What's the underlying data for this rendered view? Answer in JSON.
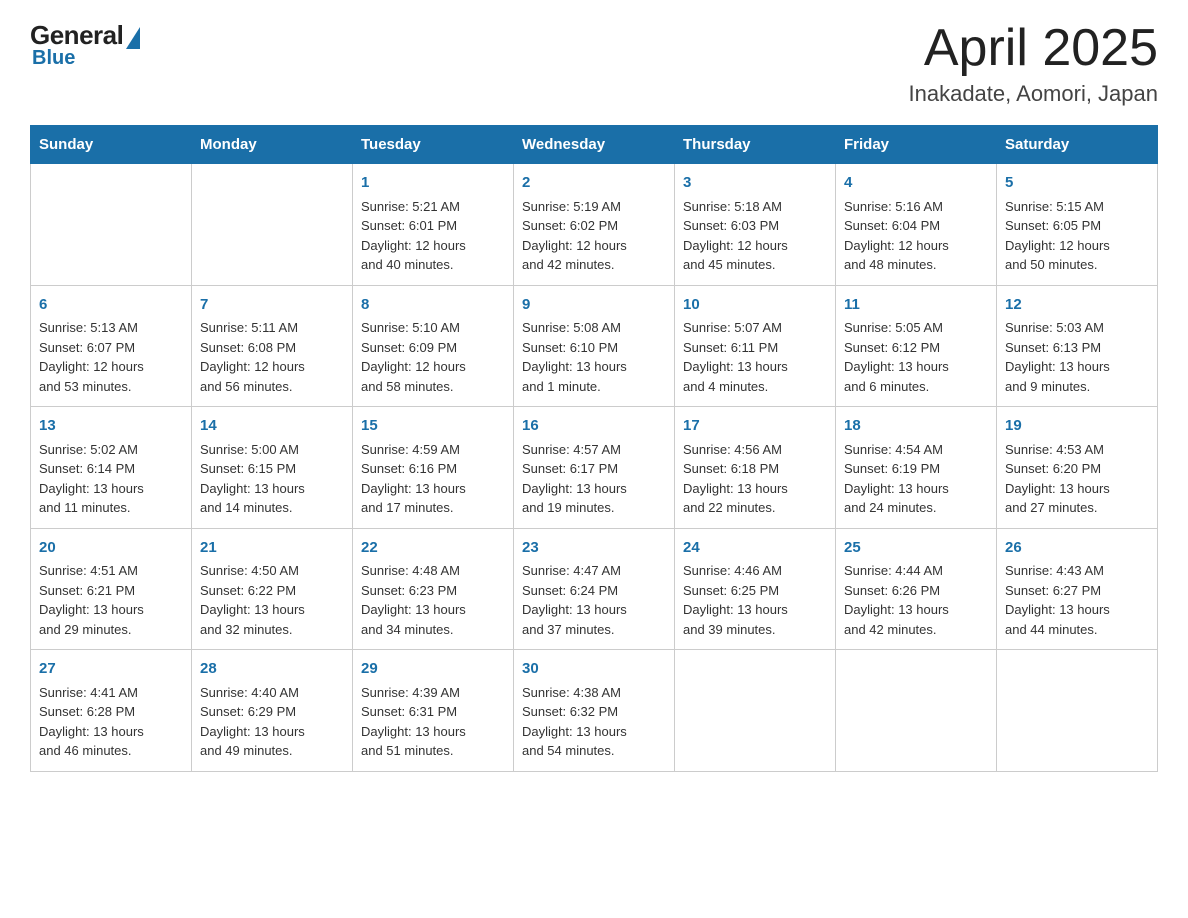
{
  "header": {
    "logo_general": "General",
    "logo_blue": "Blue",
    "title": "April 2025",
    "subtitle": "Inakadate, Aomori, Japan"
  },
  "days_of_week": [
    "Sunday",
    "Monday",
    "Tuesday",
    "Wednesday",
    "Thursday",
    "Friday",
    "Saturday"
  ],
  "weeks": [
    [
      {
        "day": "",
        "info": ""
      },
      {
        "day": "",
        "info": ""
      },
      {
        "day": "1",
        "info": "Sunrise: 5:21 AM\nSunset: 6:01 PM\nDaylight: 12 hours\nand 40 minutes."
      },
      {
        "day": "2",
        "info": "Sunrise: 5:19 AM\nSunset: 6:02 PM\nDaylight: 12 hours\nand 42 minutes."
      },
      {
        "day": "3",
        "info": "Sunrise: 5:18 AM\nSunset: 6:03 PM\nDaylight: 12 hours\nand 45 minutes."
      },
      {
        "day": "4",
        "info": "Sunrise: 5:16 AM\nSunset: 6:04 PM\nDaylight: 12 hours\nand 48 minutes."
      },
      {
        "day": "5",
        "info": "Sunrise: 5:15 AM\nSunset: 6:05 PM\nDaylight: 12 hours\nand 50 minutes."
      }
    ],
    [
      {
        "day": "6",
        "info": "Sunrise: 5:13 AM\nSunset: 6:07 PM\nDaylight: 12 hours\nand 53 minutes."
      },
      {
        "day": "7",
        "info": "Sunrise: 5:11 AM\nSunset: 6:08 PM\nDaylight: 12 hours\nand 56 minutes."
      },
      {
        "day": "8",
        "info": "Sunrise: 5:10 AM\nSunset: 6:09 PM\nDaylight: 12 hours\nand 58 minutes."
      },
      {
        "day": "9",
        "info": "Sunrise: 5:08 AM\nSunset: 6:10 PM\nDaylight: 13 hours\nand 1 minute."
      },
      {
        "day": "10",
        "info": "Sunrise: 5:07 AM\nSunset: 6:11 PM\nDaylight: 13 hours\nand 4 minutes."
      },
      {
        "day": "11",
        "info": "Sunrise: 5:05 AM\nSunset: 6:12 PM\nDaylight: 13 hours\nand 6 minutes."
      },
      {
        "day": "12",
        "info": "Sunrise: 5:03 AM\nSunset: 6:13 PM\nDaylight: 13 hours\nand 9 minutes."
      }
    ],
    [
      {
        "day": "13",
        "info": "Sunrise: 5:02 AM\nSunset: 6:14 PM\nDaylight: 13 hours\nand 11 minutes."
      },
      {
        "day": "14",
        "info": "Sunrise: 5:00 AM\nSunset: 6:15 PM\nDaylight: 13 hours\nand 14 minutes."
      },
      {
        "day": "15",
        "info": "Sunrise: 4:59 AM\nSunset: 6:16 PM\nDaylight: 13 hours\nand 17 minutes."
      },
      {
        "day": "16",
        "info": "Sunrise: 4:57 AM\nSunset: 6:17 PM\nDaylight: 13 hours\nand 19 minutes."
      },
      {
        "day": "17",
        "info": "Sunrise: 4:56 AM\nSunset: 6:18 PM\nDaylight: 13 hours\nand 22 minutes."
      },
      {
        "day": "18",
        "info": "Sunrise: 4:54 AM\nSunset: 6:19 PM\nDaylight: 13 hours\nand 24 minutes."
      },
      {
        "day": "19",
        "info": "Sunrise: 4:53 AM\nSunset: 6:20 PM\nDaylight: 13 hours\nand 27 minutes."
      }
    ],
    [
      {
        "day": "20",
        "info": "Sunrise: 4:51 AM\nSunset: 6:21 PM\nDaylight: 13 hours\nand 29 minutes."
      },
      {
        "day": "21",
        "info": "Sunrise: 4:50 AM\nSunset: 6:22 PM\nDaylight: 13 hours\nand 32 minutes."
      },
      {
        "day": "22",
        "info": "Sunrise: 4:48 AM\nSunset: 6:23 PM\nDaylight: 13 hours\nand 34 minutes."
      },
      {
        "day": "23",
        "info": "Sunrise: 4:47 AM\nSunset: 6:24 PM\nDaylight: 13 hours\nand 37 minutes."
      },
      {
        "day": "24",
        "info": "Sunrise: 4:46 AM\nSunset: 6:25 PM\nDaylight: 13 hours\nand 39 minutes."
      },
      {
        "day": "25",
        "info": "Sunrise: 4:44 AM\nSunset: 6:26 PM\nDaylight: 13 hours\nand 42 minutes."
      },
      {
        "day": "26",
        "info": "Sunrise: 4:43 AM\nSunset: 6:27 PM\nDaylight: 13 hours\nand 44 minutes."
      }
    ],
    [
      {
        "day": "27",
        "info": "Sunrise: 4:41 AM\nSunset: 6:28 PM\nDaylight: 13 hours\nand 46 minutes."
      },
      {
        "day": "28",
        "info": "Sunrise: 4:40 AM\nSunset: 6:29 PM\nDaylight: 13 hours\nand 49 minutes."
      },
      {
        "day": "29",
        "info": "Sunrise: 4:39 AM\nSunset: 6:31 PM\nDaylight: 13 hours\nand 51 minutes."
      },
      {
        "day": "30",
        "info": "Sunrise: 4:38 AM\nSunset: 6:32 PM\nDaylight: 13 hours\nand 54 minutes."
      },
      {
        "day": "",
        "info": ""
      },
      {
        "day": "",
        "info": ""
      },
      {
        "day": "",
        "info": ""
      }
    ]
  ]
}
